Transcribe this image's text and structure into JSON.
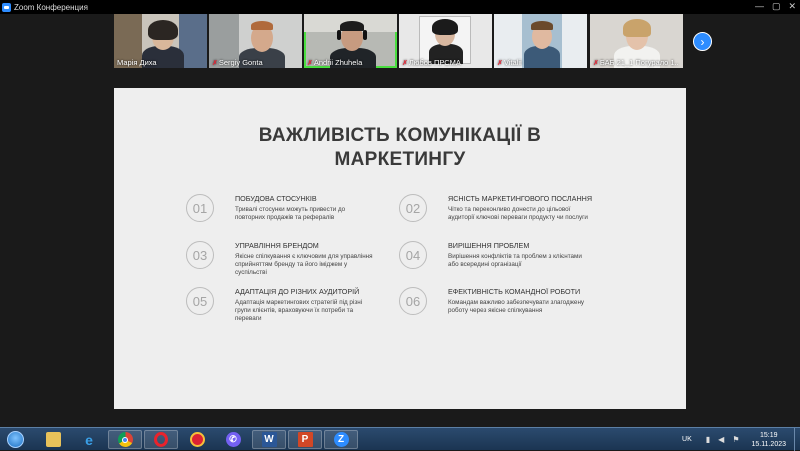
{
  "window": {
    "title": "Zoom Конференция"
  },
  "participants": [
    {
      "name": "Марія Диха",
      "muted": false
    },
    {
      "name": "Sergiy Gonta",
      "muted": true
    },
    {
      "name": "Andrii Zhuhela",
      "muted": true,
      "speaking": true
    },
    {
      "name": "Любов ПРОМАРКЕТИНГ",
      "display": "Любов ПРСМА",
      "muted": true
    },
    {
      "name": "Vitalii",
      "display": "Vitalii",
      "muted": true
    },
    {
      "name": "БАБ 21_1 Погурало Ю.",
      "display": "БАБ 21_1 Погурало 1..",
      "muted": true
    }
  ],
  "slide": {
    "title_line1": "ВАЖЛИВІСТЬ КОМУНІКАЦІЇ В",
    "title_line2": "МАРКЕТИНГУ",
    "items": [
      {
        "num": "01",
        "heading": "ПОБУДОВА СТОСУНКІВ",
        "text": "Тривалі стосунки можуть привести до повторних продажів та рефералів"
      },
      {
        "num": "02",
        "heading": "ЯСНІСТЬ МАРКЕТИНГОВОГО ПОСЛАННЯ",
        "text": "Чітко та переконливо донести до цільової аудиторії ключові переваги продукту чи послуги"
      },
      {
        "num": "03",
        "heading": "УПРАВЛІННЯ БРЕНДОМ",
        "text": "Якісне спілкування є ключовим для управління сприйняттям бренду та його іміджем у суспільстві"
      },
      {
        "num": "04",
        "heading": "ВИРІШЕННЯ ПРОБЛЕМ",
        "text": "Вирішення конфліктів та проблем з клієнтами або всередині організації"
      },
      {
        "num": "05",
        "heading": "АДАПТАЦІЯ ДО РІЗНИХ АУДИТОРІЙ",
        "text": "Адаптація маркетингових стратегій під різні групи клієнтів, враховуючи їх потреби та переваги"
      },
      {
        "num": "06",
        "heading": "ЕФЕКТИВНІСТЬ КОМАНДНОЇ РОБОТИ",
        "text": "Командам важливо забезпечувати злагоджену роботу через якісне спілкування"
      }
    ]
  },
  "taskbar": {
    "lang": "UK",
    "time": "15:19",
    "date": "15.11.2023",
    "apps": [
      "file-explorer-icon",
      "internet-explorer-icon",
      "chrome-icon",
      "opera-icon",
      "screenshot-tool-icon",
      "viber-icon",
      "word-icon",
      "powerpoint-icon",
      "zoom-icon"
    ]
  },
  "colors": {
    "zoom_blue": "#2d8cff",
    "active_speaker": "#4ade40",
    "slide_bg": "#eeeeee"
  }
}
